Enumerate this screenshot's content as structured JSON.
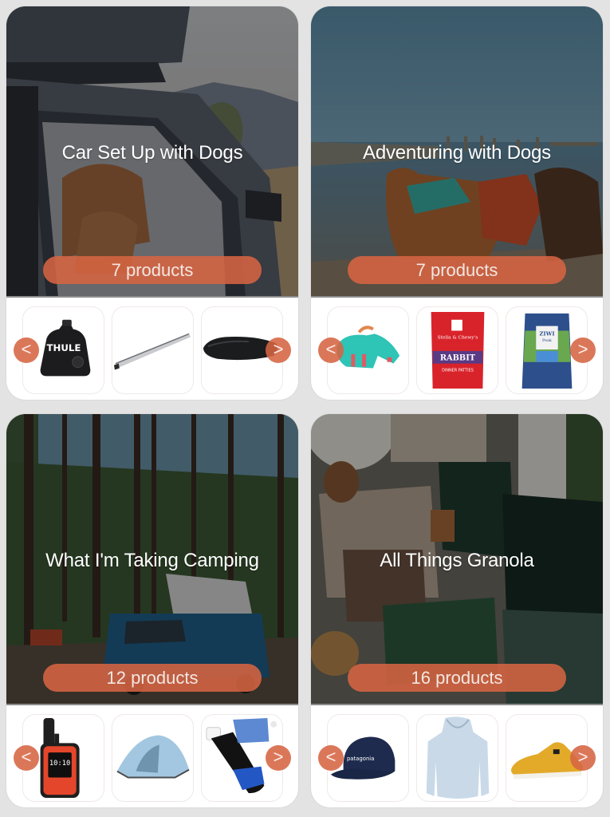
{
  "theme": {
    "accent": "#D66442",
    "page_bg": "#E3E3E3",
    "card_bg": "#FFFFFF"
  },
  "collections": [
    {
      "title": "Car Set Up with Dogs",
      "count_label": "7 products",
      "prev_label": "<",
      "next_label": ">",
      "products": [
        {
          "name": "Thule roof rack foot pack",
          "icon": "roof-rack-foot-icon"
        },
        {
          "name": "Roof rack crossbar",
          "icon": "crossbar-icon"
        },
        {
          "name": "Rooftop cargo box",
          "icon": "cargo-box-icon"
        }
      ]
    },
    {
      "title": "Adventuring with Dogs",
      "count_label": "7 products",
      "prev_label": "<",
      "next_label": ">",
      "products": [
        {
          "name": "Dog life jacket",
          "icon": "dog-life-jacket-icon"
        },
        {
          "name": "Stella & Chewy's Absolutely Rabbit Dinner Patties",
          "icon": "dog-food-bag-icon"
        },
        {
          "name": "Ziwi Peak Lamb Recipe dog food",
          "icon": "dog-food-bag-icon"
        }
      ]
    },
    {
      "title": "What I'm Taking Camping",
      "count_label": "12 products",
      "prev_label": "<",
      "next_label": ">",
      "products": [
        {
          "name": "Garmin inReach Mini satellite communicator",
          "icon": "gps-device-icon",
          "screen_text": "10:10"
        },
        {
          "name": "Backpacking tent",
          "icon": "tent-icon"
        },
        {
          "name": "Sawyer water filter kit",
          "icon": "water-filter-icon"
        }
      ]
    },
    {
      "title": "All Things Granola",
      "count_label": "16 products",
      "prev_label": "<",
      "next_label": ">",
      "products": [
        {
          "name": "Patagonia cap",
          "icon": "cap-icon",
          "label": "patagonia"
        },
        {
          "name": "Light blue sun hoodie",
          "icon": "hoodie-icon"
        },
        {
          "name": "Yellow slip-on shoe",
          "icon": "shoe-icon"
        }
      ]
    }
  ]
}
